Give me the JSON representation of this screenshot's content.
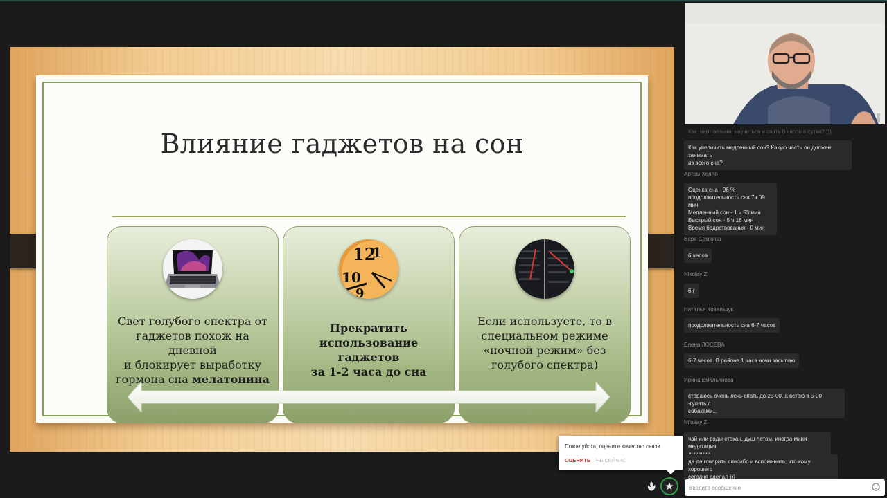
{
  "slide": {
    "title": "Влияние гаджетов на сон",
    "card1": {
      "line1": "Свет голубого спектра от",
      "line2": "гаджетов похож на дневной",
      "line3": "и блокирует выработку",
      "line4_prefix": "гормона сна ",
      "line4_bold": "мелатонина",
      "image": "laptop-image"
    },
    "card2": {
      "line1": "Прекратить",
      "line2": "использование гаджетов",
      "line3": "за 1-2 часа до сна",
      "image": "clock-image"
    },
    "card3": {
      "line1": "Если используете, то в",
      "line2": "специальном режиме",
      "line3": "«ночной режим» без",
      "line4": "голубого спектра)",
      "image": "phone-night-mode-image"
    },
    "arrow": "double-arrow-icon"
  },
  "chat": {
    "faded_top": "Как, черт возьми, научиться и спать 8 часов в сутки? )))",
    "messages": [
      {
        "author": "",
        "text": "Как увеличить медленный сон? Какую часть он должен занимать\nиз всего сна?"
      },
      {
        "author": "Артем Холло",
        "text": "Оценка сна - 96 %\nпродолжительность сна  7ч 09 мин\nМедленный сон - 1 ч 53 мин\nБыстрый сон - 5 ч 16 мин\nВремя бодрствования - 0 мин"
      },
      {
        "author": "Вера Семкина",
        "text": "6 часов"
      },
      {
        "author": "Nikolay Z",
        "text": "6 ("
      },
      {
        "author": "Наталья Ковальчук",
        "text": "продолжительность сна 6-7 часов"
      },
      {
        "author": "Елена ЛОСЕВА",
        "text": "6-7 часов. В районе  1 часа ночи засыпаю"
      },
      {
        "author": "Ирина Емельянова",
        "text": "стараюсь очень лечь спать до 23-00, а встаю в 5-00 -гулять с\nсобаками..."
      },
      {
        "author": "Nikolay Z",
        "text": "чай или воды стакан, душ летом, иногда мини медитация\nдыхание."
      },
      {
        "author": "",
        "text": "да да говорить спасибо и вспоминать, что кому хорошего\nсегодня сделал )))"
      }
    ],
    "input_placeholder": "Введите сообщение"
  },
  "rating": {
    "question": "Пожалуйста, оцените качество связи",
    "rate_label": "ОЦЕНИТЬ",
    "later_label": "НЕ СЕЙЧАС"
  },
  "colors": {
    "background": "#1b1b1b",
    "card_green": "#a4b884",
    "accent_red": "#d0353f",
    "star_ring": "#2f9d45"
  }
}
